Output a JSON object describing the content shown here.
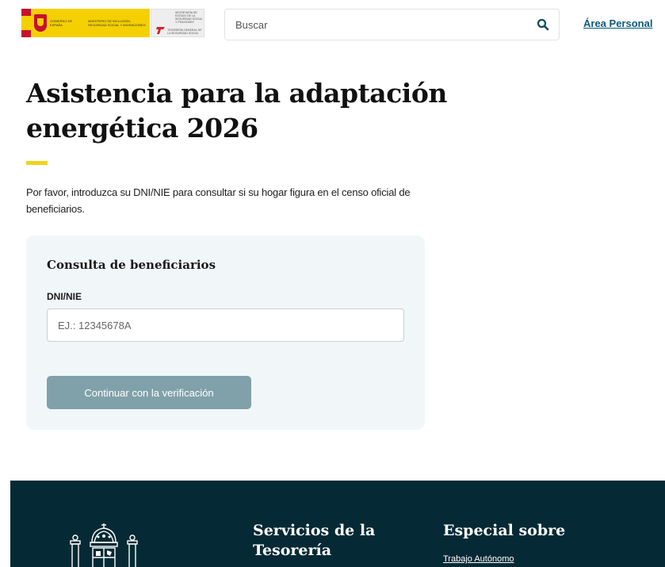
{
  "header": {
    "logo_gov_line1": "Gobierno de España",
    "logo_gov_line2": "Ministerio de Inclusión, Seguridad Social y Migraciones",
    "logo_tgss_line1": "Secretaría de Estado de la Seguridad Social y Pensiones",
    "logo_tgss_line2": "Tesorería General de la Seguridad Social",
    "search_placeholder": "Buscar",
    "area_personal": "Área Personal"
  },
  "main": {
    "title": "Asistencia para la adaptación energética 2026",
    "intro": "Por favor, introduzca su DNI/NIE para consultar si su hogar figura en el censo oficial de beneficiarios."
  },
  "form": {
    "title": "Consulta de beneficiarios",
    "field_label": "DNI/NIE",
    "field_placeholder": "EJ.: 12345678A",
    "submit_label": "Continuar con la verificación"
  },
  "footer": {
    "col1_title": "Servicios de la Tesorería",
    "col2_title": "Especial sobre",
    "col2_link": "Trabajo Autónomo"
  },
  "colors": {
    "accent_yellow": "#f0d31e",
    "link": "#0b5a7a",
    "footer_bg": "#052a35",
    "button_bg": "#80a1aa",
    "card_bg": "#f1f7f9"
  },
  "icons": {
    "search": "search-icon",
    "coat_of_arms": "coat-of-arms-icon"
  }
}
